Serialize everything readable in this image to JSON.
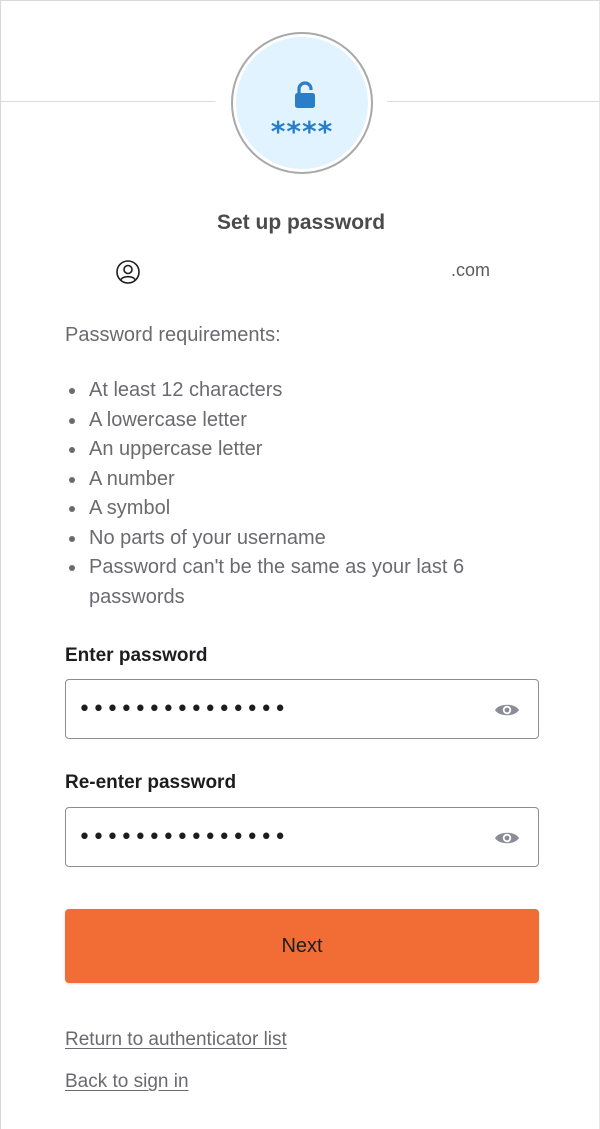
{
  "header": {
    "badge_icon": "lock-open-icon",
    "badge_stars": "****",
    "title": "Set up password"
  },
  "identity": {
    "icon": "user-circle-icon",
    "email": ".com"
  },
  "requirements": {
    "title": "Password requirements:",
    "items": [
      "At least 12 characters",
      "A lowercase letter",
      "An uppercase letter",
      "A number",
      "A symbol",
      "No parts of your username",
      "Password can't be the same as your last 6 passwords"
    ]
  },
  "form": {
    "password_label": "Enter password",
    "password_value": "•••••••••••••••",
    "confirm_label": "Re-enter password",
    "confirm_value": "•••••••••••••••",
    "show_icon": "eye-icon",
    "next_label": "Next"
  },
  "links": {
    "authenticator_list": "Return to authenticator list",
    "back_to_sign_in": "Back to sign in"
  },
  "colors": {
    "accent": "#f26d35",
    "badge_bg": "#e1f3fe",
    "badge_icon": "#2a7ec8"
  }
}
